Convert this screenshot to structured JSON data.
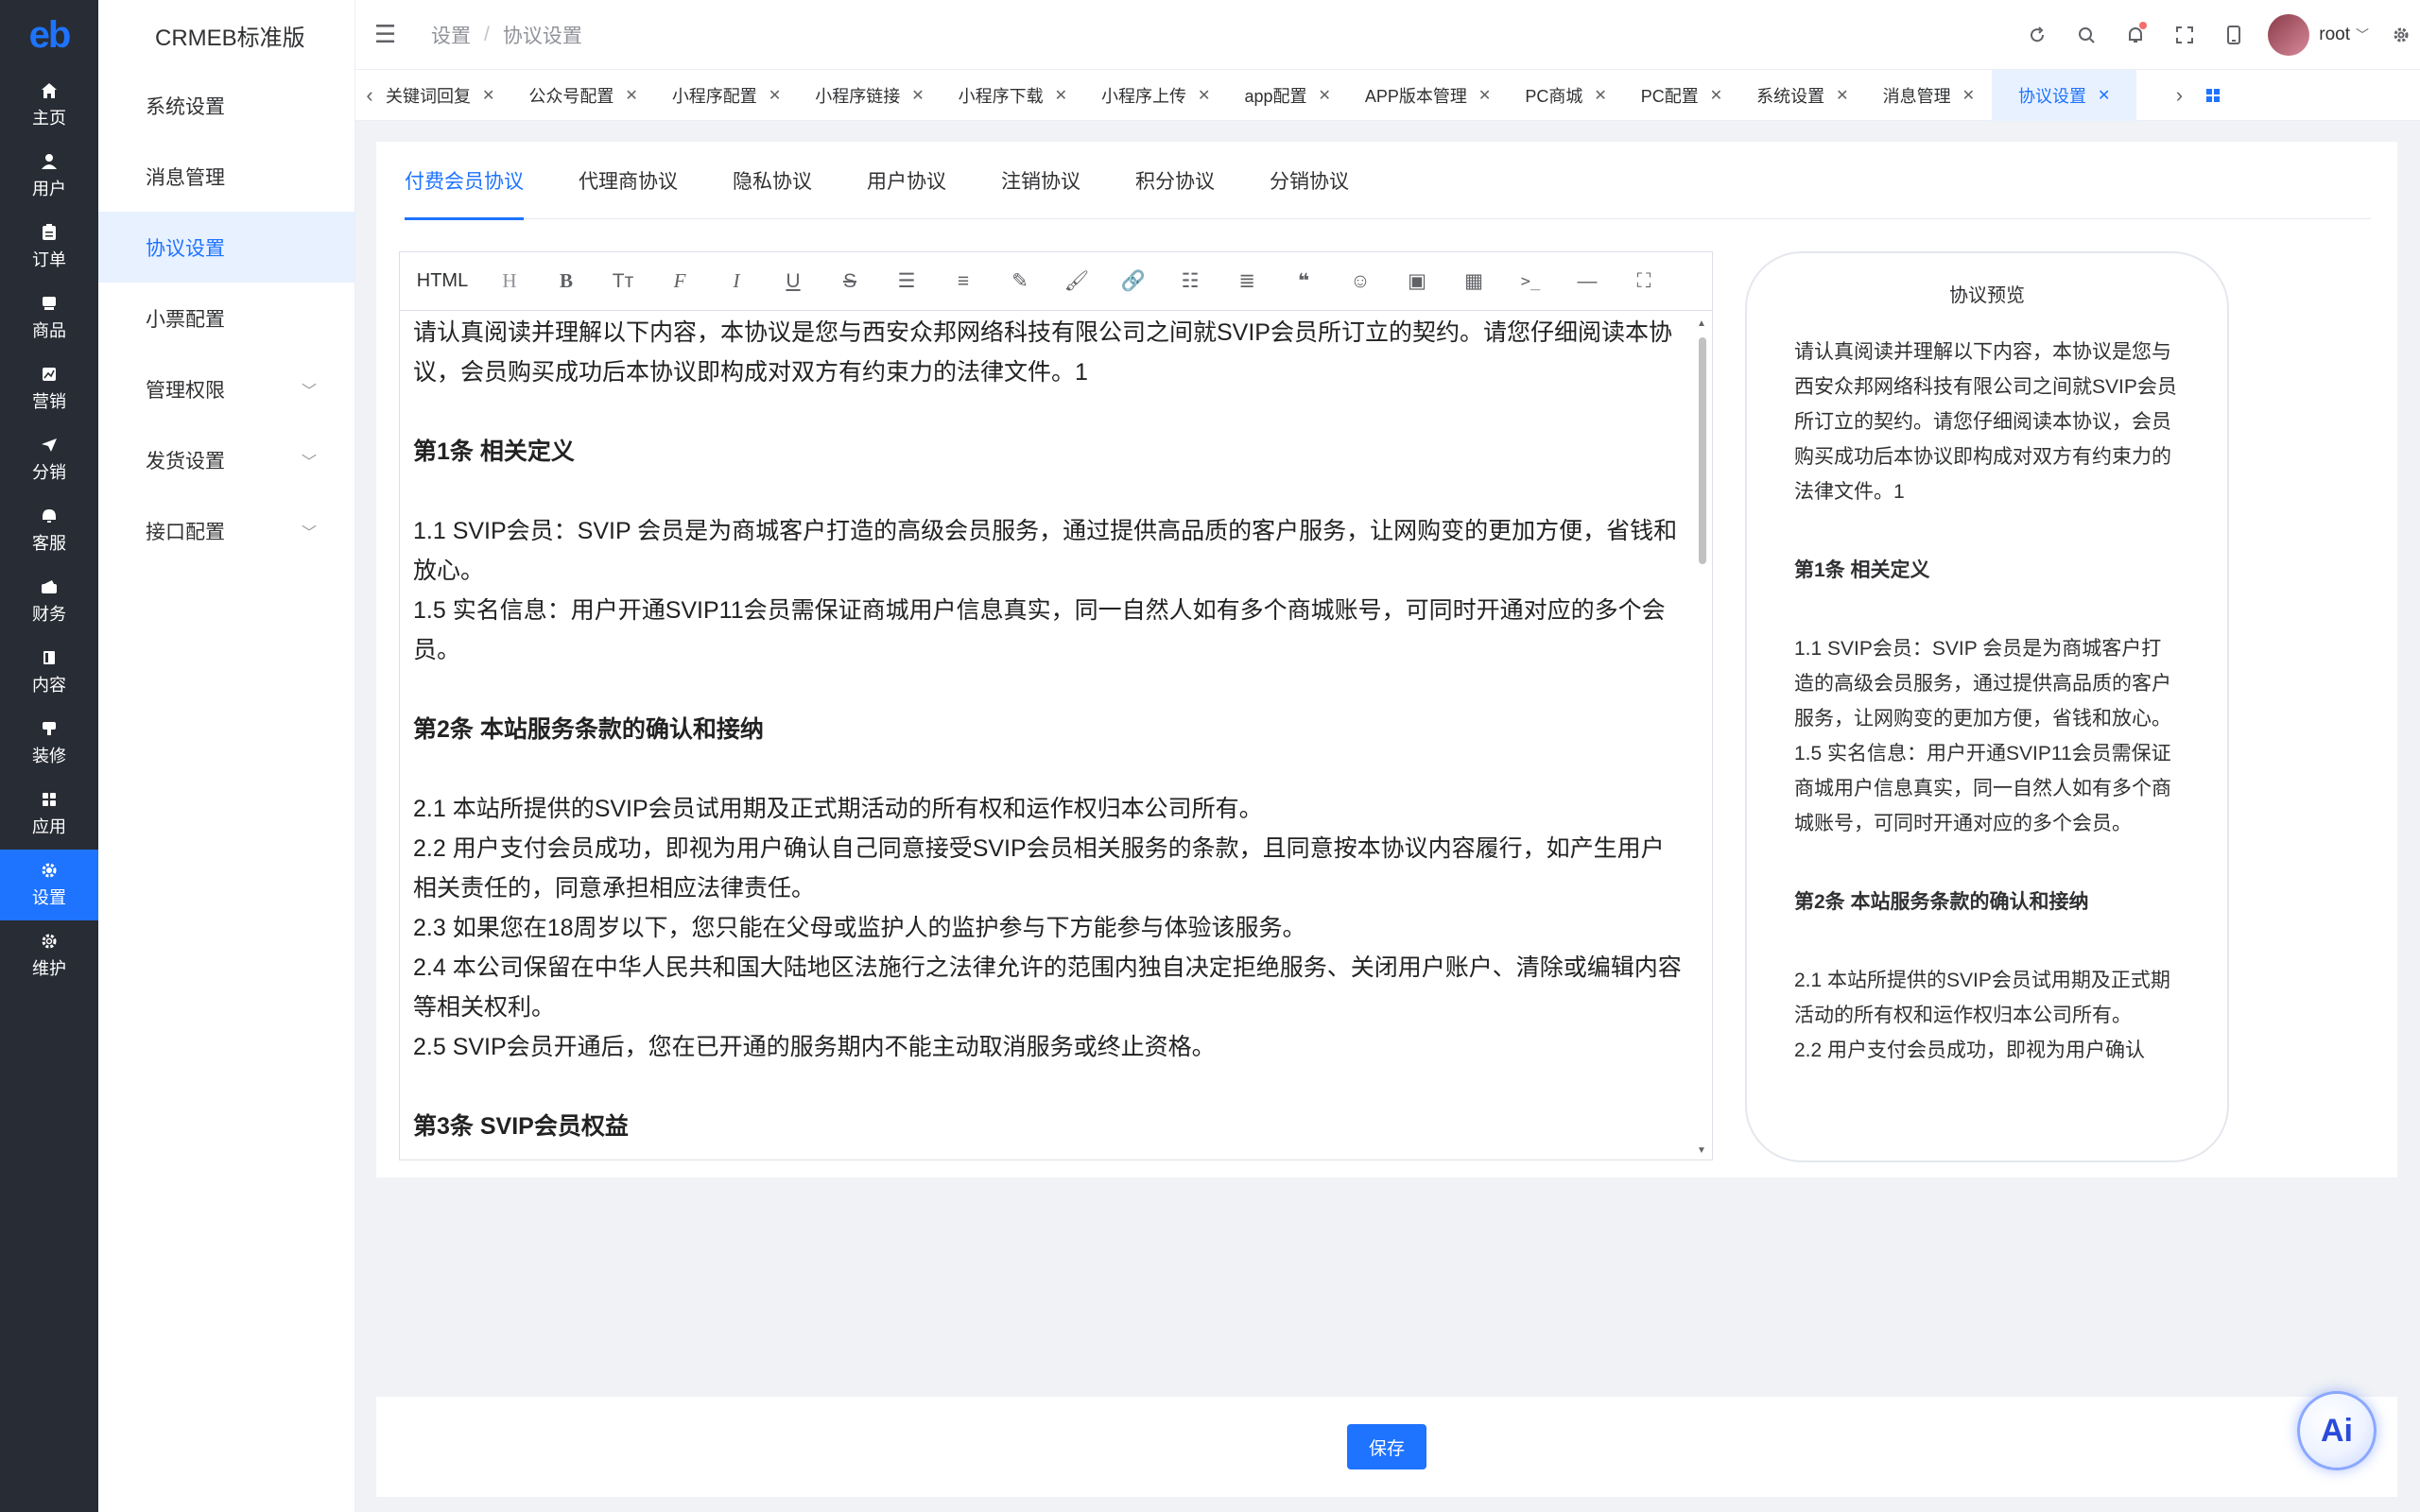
{
  "rail": {
    "logo": "eb",
    "items": [
      {
        "label": "主页",
        "icon": "home-icon"
      },
      {
        "label": "用户",
        "icon": "user-icon"
      },
      {
        "label": "订单",
        "icon": "order-icon"
      },
      {
        "label": "商品",
        "icon": "product-icon"
      },
      {
        "label": "营销",
        "icon": "marketing-icon"
      },
      {
        "label": "分销",
        "icon": "distribution-icon"
      },
      {
        "label": "客服",
        "icon": "service-icon"
      },
      {
        "label": "财务",
        "icon": "finance-icon"
      },
      {
        "label": "内容",
        "icon": "content-icon"
      },
      {
        "label": "装修",
        "icon": "decoration-icon"
      },
      {
        "label": "应用",
        "icon": "apps-icon"
      },
      {
        "label": "设置",
        "icon": "settings-icon"
      },
      {
        "label": "维护",
        "icon": "maintenance-icon"
      }
    ]
  },
  "submenu": {
    "brand": "CRMEB标准版",
    "items": [
      {
        "label": "系统设置"
      },
      {
        "label": "消息管理"
      },
      {
        "label": "协议设置"
      },
      {
        "label": "小票配置"
      },
      {
        "label": "管理权限"
      },
      {
        "label": "发货设置"
      },
      {
        "label": "接口配置"
      }
    ]
  },
  "header": {
    "breadcrumb": [
      "设置",
      "协议设置"
    ],
    "username": "root"
  },
  "tags": [
    "关键词回复",
    "公众号配置",
    "小程序配置",
    "小程序链接",
    "小程序下载",
    "小程序上传",
    "app配置",
    "APP版本管理",
    "PC商城",
    "PC配置",
    "系统设置",
    "消息管理",
    "协议设置"
  ],
  "tabs": [
    "付费会员协议",
    "代理商协议",
    "隐私协议",
    "用户协议",
    "注销协议",
    "积分协议",
    "分销协议"
  ],
  "editor": {
    "html_label": "HTML",
    "intro": "请认真阅读并理解以下内容，本协议是您与西安众邦网络科技有限公司之间就SVIP会员所订立的契约。请您仔细阅读本协议，会员购买成功后本协议即构成对双方有约束力的法律文件。1",
    "s1_title": "第1条 相关定义",
    "s1_1": "1.1 SVIP会员：SVIP 会员是为商城客户打造的高级会员服务，通过提供高品质的客户服务，让网购变的更加方便，省钱和放心。",
    "s1_5": "1.5 实名信息：用户开通SVIP11会员需保证商城用户信息真实，同一自然人如有多个商城账号，可同时开通对应的多个会员。",
    "s2_title": "第2条 本站服务条款的确认和接纳",
    "s2_1": "2.1 本站所提供的SVIP会员试用期及正式期活动的所有权和运作权归本公司所有。",
    "s2_2": "2.2 用户支付会员成功，即视为用户确认自己同意接受SVIP会员相关服务的条款，且同意按本协议内容履行，如产生用户相关责任的，同意承担相应法律责任。",
    "s2_3": "2.3 如果您在18周岁以下，您只能在父母或监护人的监护参与下方能参与体验该服务。",
    "s2_4": "2.4 本公司保留在中华人民共和国大陆地区法施行之法律允许的范围内独自决定拒绝服务、关闭用户账户、清除或编辑内容等相关权利。",
    "s2_5": "2.5 SVIP会员开通后，您在已开通的服务期内不能主动取消服务或终止资格。",
    "s3_title": "第3条 SVIP会员权益"
  },
  "preview": {
    "title": "协议预览",
    "s2_2_partial": "2.2 用户支付会员成功，即视为用户确认"
  },
  "footer": {
    "save_label": "保存"
  },
  "ai": {
    "label": "Ai"
  }
}
